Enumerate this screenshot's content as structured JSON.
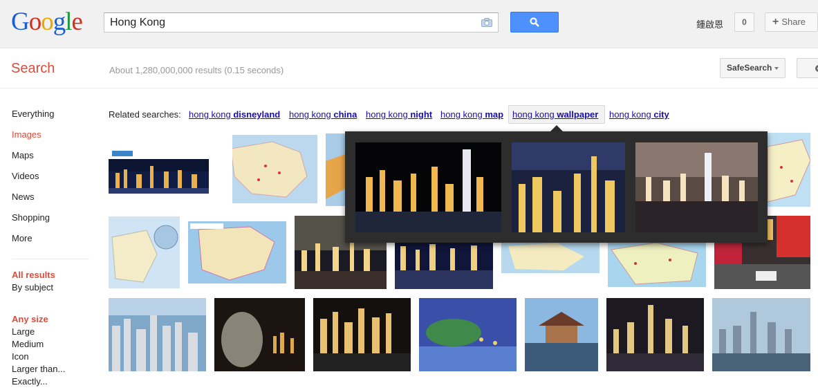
{
  "header": {
    "search_query": "Hong Kong",
    "user_name": "鍾啟恩",
    "notification_count": "0",
    "share_label": "Share",
    "share_plus": "+"
  },
  "subheader": {
    "title": "Search",
    "result_stats": "About 1,280,000,000 results (0.15 seconds)",
    "safesearch_label": "SafeSearch"
  },
  "nav": {
    "items": [
      {
        "label": "Everything",
        "active": false
      },
      {
        "label": "Images",
        "active": true
      },
      {
        "label": "Maps",
        "active": false
      },
      {
        "label": "Videos",
        "active": false
      },
      {
        "label": "News",
        "active": false
      },
      {
        "label": "Shopping",
        "active": false
      },
      {
        "label": "More",
        "active": false
      }
    ],
    "results_filter": {
      "selected": "All results",
      "option": "By subject"
    },
    "size_filter": {
      "selected": "Any size",
      "options": [
        "Large",
        "Medium",
        "Icon",
        "Larger than...",
        "Exactly..."
      ]
    }
  },
  "related": {
    "label": "Related searches:",
    "links": [
      {
        "prefix": "hong kong ",
        "bold": "disneyland"
      },
      {
        "prefix": "hong kong ",
        "bold": "china"
      },
      {
        "prefix": "hong kong ",
        "bold": "night"
      },
      {
        "prefix": "hong kong ",
        "bold": "map"
      },
      {
        "prefix": "hong kong ",
        "bold": "wallpaper"
      },
      {
        "prefix": "hong kong ",
        "bold": "city"
      }
    ],
    "hovered": "wallpaper"
  },
  "colors": {
    "accent_red": "#dd4b39",
    "link_blue": "#1a0dab",
    "search_button": "#4d90fe",
    "popup_bg": "#2d2d2d"
  },
  "icons": [
    "camera-icon",
    "magnifier-icon",
    "caret-down-icon",
    "gear-icon"
  ],
  "images": {
    "row1": [
      "night-skyline",
      "map",
      "map",
      "map"
    ],
    "row2": [
      "map",
      "map",
      "night-skyline",
      "night-skyline",
      "map",
      "map",
      "street"
    ],
    "row3": [
      "city-day",
      "statue-night",
      "night-skyline",
      "garden-dusk",
      "pavilion",
      "night-skyline",
      "city-day"
    ],
    "popup": [
      "night-skyline",
      "night-skyline",
      "night-skyline"
    ]
  }
}
